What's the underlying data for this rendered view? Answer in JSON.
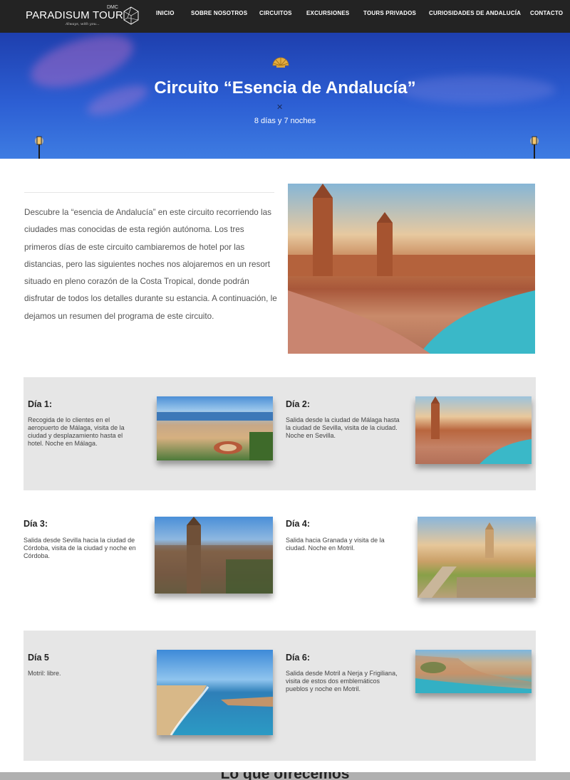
{
  "logo": {
    "name": "PARADISUM TOUR",
    "dmc": "DMC",
    "tagline": "Always, with you..."
  },
  "nav": {
    "items": [
      "INICIO",
      "SOBRE NOSOTROS",
      "CIRCUITOS",
      "EXCURSIONES",
      "TOURS PRIVADOS",
      "CURIOSIDADES DE ANDALUCÍA",
      "CONTACTO"
    ]
  },
  "hero": {
    "title": "Circuito “Esencia de Andalucía”",
    "separator": "✕",
    "subtitle": "8 días y 7 noches"
  },
  "intro": {
    "text": "Descubre la “esencia de Andalucía” en este circuito recorriendo las ciudades mas conocidas de esta región autónoma. Los tres primeros días de este circuito cambiaremos de hotel por las distancias, pero las siguientes noches nos alojaremos en un resort situado en pleno corazón de la Costa Tropical, donde podrán disfrutar de todos los detalles durante su estancia. A continuación, le dejamos un resumen del programa de este circuito."
  },
  "days": [
    {
      "title": "Día 1:",
      "desc": "Recogida de lo clientes en el aeropuerto de Málaga, visita de la ciudad y desplazamiento hasta el hotel. Noche en Málaga."
    },
    {
      "title": "Día 2:",
      "desc": "Salida desde la ciudad de Málaga hasta la ciudad de Sevilla, visita de la ciudad.  Noche en Sevilla."
    },
    {
      "title": "Día 3:",
      "desc": "Salida desde Sevilla hacia la ciudad de Córdoba, visita de la ciudad y noche en Córdoba."
    },
    {
      "title": "Día 4:",
      "desc": "Salida hacia Granada y visita de la ciudad. Noche en Motril."
    },
    {
      "title": "Día 5",
      "desc": "Motril: libre."
    },
    {
      "title": "Día 6:",
      "desc": "Salida desde Motril a Nerja y Frigiliana, visita de estos dos emblemáticos pueblos y noche en Motril."
    }
  ],
  "bottom": {
    "title": "Lo que ofrecemos"
  },
  "colors": {
    "header_bg": "#232323",
    "band_bg": "#e6e6e6",
    "hero_blue": "#2c5ed3",
    "gold": "#d9a23a"
  },
  "icons": [
    "logo-gem-icon",
    "shell-icon",
    "lamp-icon",
    "close-x-icon"
  ]
}
